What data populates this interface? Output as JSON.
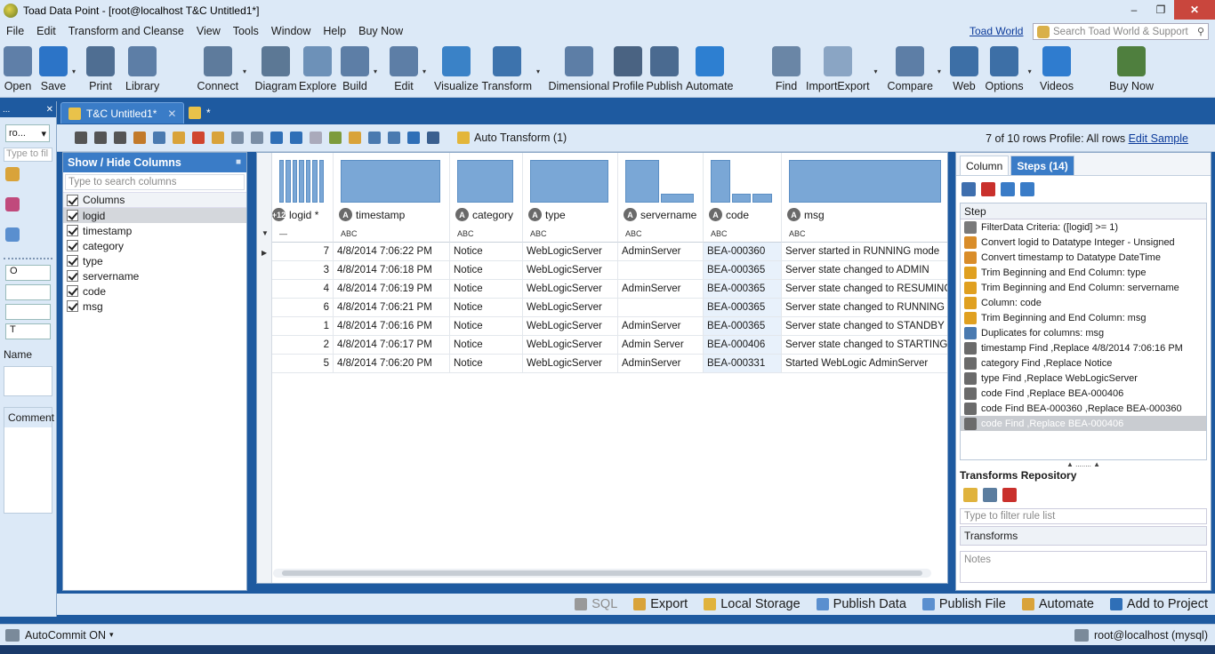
{
  "window": {
    "title": "Toad Data Point - [root@localhost T&C  Untitled1*]"
  },
  "menu": [
    "File",
    "Edit",
    "Transform and Cleanse",
    "View",
    "Tools",
    "Window",
    "Help",
    "Buy Now"
  ],
  "toad_world_link": "Toad World",
  "search": {
    "placeholder": "Search Toad World & Support"
  },
  "toolbar": [
    {
      "label": "Open",
      "icon": "open-folder-icon",
      "color": "#5f7fa8"
    },
    {
      "label": "Save",
      "icon": "save-disk-icon",
      "color": "#2c74c7"
    },
    {
      "label": "Print",
      "icon": "printer-icon",
      "color": "#4f6e92"
    },
    {
      "label": "Library",
      "icon": "library-icon",
      "color": "#5d7ea6"
    },
    {
      "label": "Connect",
      "icon": "plug-icon",
      "color": "#5e7b9c"
    },
    {
      "label": "Diagram",
      "icon": "diagram-icon",
      "color": "#5c7895"
    },
    {
      "label": "Explore",
      "icon": "explore-icon",
      "color": "#6d91b8"
    },
    {
      "label": "Build",
      "icon": "build-icon",
      "color": "#5d7ea6"
    },
    {
      "label": "Edit",
      "icon": "edit-icon",
      "color": "#5d7ea6"
    },
    {
      "label": "Visualize",
      "icon": "visualize-icon",
      "color": "#3a82c7"
    },
    {
      "label": "Transform",
      "icon": "transform-icon",
      "color": "#3d73ad"
    },
    {
      "label": "Dimensional",
      "icon": "dimensional-icon",
      "color": "#5d7ea6"
    },
    {
      "label": "Profile",
      "icon": "profile-icon",
      "color": "#4a6382"
    },
    {
      "label": "Publish",
      "icon": "publish-icon",
      "color": "#4a6a90"
    },
    {
      "label": "Automate",
      "icon": "automate-icon",
      "color": "#2d7fd1"
    },
    {
      "label": "Find",
      "icon": "find-icon",
      "color": "#6a86a6"
    },
    {
      "label": "ImportExport",
      "icon": "import-export-icon",
      "color": "#8aa5c4"
    },
    {
      "label": "Compare",
      "icon": "compare-icon",
      "color": "#5d7ea6"
    },
    {
      "label": "Web",
      "icon": "web-globe-icon",
      "color": "#3d6fa6"
    },
    {
      "label": "Options",
      "icon": "options-icon",
      "color": "#3d6fa6"
    },
    {
      "label": "Videos",
      "icon": "videos-icon",
      "color": "#2f7ccf"
    },
    {
      "label": "Buy Now",
      "icon": "cart-icon",
      "color": "#4f7f3e"
    }
  ],
  "tabs": [
    {
      "label": "T&C  Untitled1*",
      "active": true
    },
    {
      "label": "*",
      "active": false
    }
  ],
  "left_nav": {
    "combo_value": "ro...",
    "filter_placeholder": "Type to fil",
    "box_value": "O",
    "box2_value": "T",
    "name_label": "Name",
    "comment_label": "Comment"
  },
  "columns_panel": {
    "title": "Show / Hide Columns",
    "search_placeholder": "Type to search columns",
    "group": "Columns",
    "items": [
      "logid",
      "timestamp",
      "category",
      "type",
      "servername",
      "code",
      "msg"
    ]
  },
  "editor_toolbar": {
    "auto_transform": "Auto Transform (1)",
    "row_info": "7 of 10 rows  Profile: All rows ",
    "edit_sample": "Edit Sample"
  },
  "grid": {
    "columns": [
      {
        "name": "logid *",
        "type_badge": "+12",
        "type_label": "—"
      },
      {
        "name": "timestamp",
        "type_badge": "A",
        "type_label": "ABC"
      },
      {
        "name": "category",
        "type_badge": "A",
        "type_label": "ABC"
      },
      {
        "name": "type",
        "type_badge": "A",
        "type_label": "ABC"
      },
      {
        "name": "servername",
        "type_badge": "A",
        "type_label": "ABC"
      },
      {
        "name": "code",
        "type_badge": "A",
        "type_label": "ABC"
      },
      {
        "name": "msg",
        "type_badge": "A",
        "type_label": "ABC"
      }
    ],
    "profile_bar_fill": {
      "logid": [
        1,
        1,
        1,
        1,
        1,
        1,
        1
      ],
      "timestamp": [
        1
      ],
      "category": [
        1
      ],
      "type": [
        1
      ],
      "servername": [
        1,
        0.2
      ],
      "code": [
        1,
        0.2,
        0.2
      ],
      "msg": [
        1
      ]
    },
    "rows": [
      [
        "7",
        "4/8/2014 7:06:22 PM",
        "Notice",
        "WebLogicServer",
        "AdminServer",
        "BEA-000360",
        "Server started in RUNNING mode"
      ],
      [
        "3",
        "4/8/2014 7:06:18 PM",
        "Notice",
        "WebLogicServer",
        "",
        "BEA-000365",
        "Server state changed to ADMIN"
      ],
      [
        "4",
        "4/8/2014 7:06:19 PM",
        "Notice",
        "WebLogicServer",
        "AdminServer",
        "BEA-000365",
        "Server state changed to RESUMING"
      ],
      [
        "6",
        "4/8/2014 7:06:21 PM",
        "Notice",
        "WebLogicServer",
        "",
        "BEA-000365",
        "Server state changed to RUNNING"
      ],
      [
        "1",
        "4/8/2014 7:06:16 PM",
        "Notice",
        "WebLogicServer",
        "AdminServer",
        "BEA-000365",
        "Server state changed to STANDBY"
      ],
      [
        "2",
        "4/8/2014 7:06:17 PM",
        "Notice",
        "WebLogicServer",
        "Admin Server",
        "BEA-000406",
        "Server state changed to STARTING"
      ],
      [
        "5",
        "4/8/2014 7:06:20 PM",
        "Notice",
        "WebLogicServer",
        "AdminServer",
        "BEA-000331",
        "Started WebLogic AdminServer"
      ]
    ]
  },
  "right_panel": {
    "tabs": [
      "Column",
      "Steps (14)"
    ],
    "steps_header": "Step",
    "steps": [
      {
        "text": "FilterData Criteria: ([logid] >= 1)",
        "icon": "filter-icon"
      },
      {
        "text": "Convert logid to Datatype Integer - Unsigned",
        "icon": "convert-icon"
      },
      {
        "text": "Convert timestamp to Datatype DateTime",
        "icon": "convert-icon"
      },
      {
        "text": "Trim Beginning and End Column: type",
        "icon": "trim-icon"
      },
      {
        "text": "Trim Beginning and End Column: servername",
        "icon": "trim-icon"
      },
      {
        "text": "Column: code",
        "icon": "trim-icon"
      },
      {
        "text": "Trim Beginning and End Column: msg",
        "icon": "trim-icon"
      },
      {
        "text": "Duplicates for columns: msg",
        "icon": "duplicates-icon"
      },
      {
        "text": "timestamp Find ,Replace 4/8/2014 7:06:16 PM",
        "icon": "find-replace-icon"
      },
      {
        "text": "category Find ,Replace Notice",
        "icon": "find-replace-icon"
      },
      {
        "text": "type Find ,Replace WebLogicServer",
        "icon": "find-replace-icon"
      },
      {
        "text": "code Find ,Replace BEA-000406",
        "icon": "find-replace-icon"
      },
      {
        "text": "code Find BEA-000360 ,Replace BEA-000360",
        "icon": "find-replace-icon"
      },
      {
        "text": "code Find  ,Replace BEA-000406",
        "icon": "find-replace-icon",
        "selected": true
      }
    ],
    "repo_title": "Transforms Repository",
    "filter_placeholder": "Type to filter rule list",
    "transforms_label": "Transforms",
    "notes_placeholder": "Notes"
  },
  "action_bar": [
    {
      "label": "SQL",
      "disabled": true,
      "icon": "sql-icon"
    },
    {
      "label": "Export",
      "disabled": false,
      "icon": "export-icon"
    },
    {
      "label": "Local Storage",
      "disabled": false,
      "icon": "local-storage-icon"
    },
    {
      "label": "Publish Data",
      "disabled": false,
      "icon": "publish-data-icon"
    },
    {
      "label": "Publish File",
      "disabled": false,
      "icon": "publish-file-icon"
    },
    {
      "label": "Automate",
      "disabled": false,
      "icon": "automate-icon"
    },
    {
      "label": "Add to Project",
      "disabled": false,
      "icon": "add-to-project-icon"
    }
  ],
  "status": {
    "autocommit": "AutoCommit ON",
    "connection": "root@localhost (mysql)"
  },
  "colors": {
    "accent": "#3a7cc7",
    "chrome": "#dce9f7",
    "frame": "#1e5aa0",
    "profile_bar": "#7aa7d6"
  }
}
